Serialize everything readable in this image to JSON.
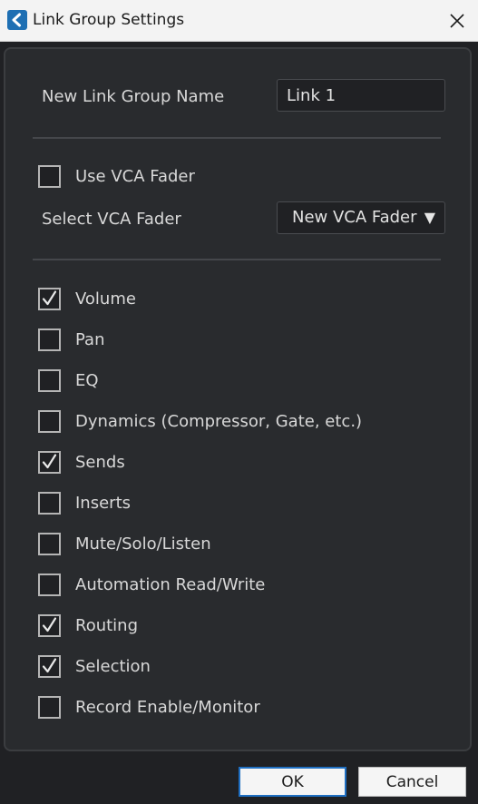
{
  "window": {
    "title": "Link Group Settings"
  },
  "name_field": {
    "label": "New Link Group Name",
    "value": "Link 1"
  },
  "vca": {
    "use_label": "Use VCA Fader",
    "use_checked": false,
    "select_label": "Select VCA Fader",
    "selected_value": "New VCA Fader",
    "arrow": "▼"
  },
  "options": [
    {
      "label": "Volume",
      "checked": true
    },
    {
      "label": "Pan",
      "checked": false
    },
    {
      "label": "EQ",
      "checked": false
    },
    {
      "label": "Dynamics (Compressor, Gate, etc.)",
      "checked": false
    },
    {
      "label": "Sends",
      "checked": true
    },
    {
      "label": "Inserts",
      "checked": false
    },
    {
      "label": "Mute/Solo/Listen",
      "checked": false
    },
    {
      "label": "Automation Read/Write",
      "checked": false
    },
    {
      "label": "Routing",
      "checked": true
    },
    {
      "label": "Selection",
      "checked": true
    },
    {
      "label": "Record Enable/Monitor",
      "checked": false
    }
  ],
  "buttons": {
    "ok": "OK",
    "cancel": "Cancel"
  },
  "colors": {
    "accent": "#1f6fc2",
    "panel": "#292b2e",
    "background": "#202124"
  }
}
